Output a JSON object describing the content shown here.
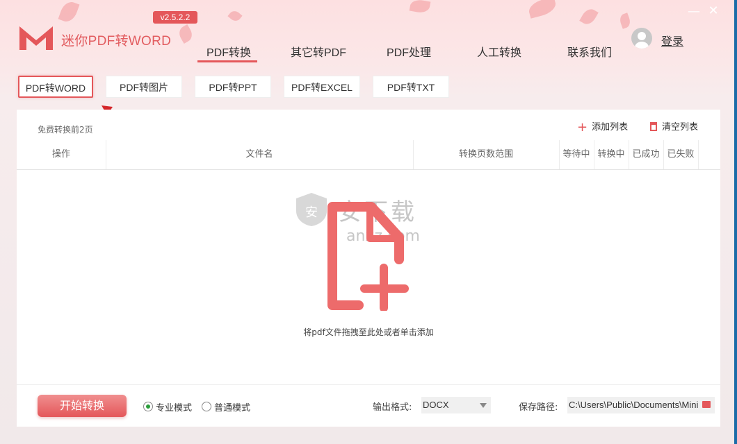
{
  "header": {
    "app_title": "迷你PDF转WORD",
    "version": "v2.5.2.2",
    "nav": [
      "PDF转换",
      "其它转PDF",
      "PDF处理",
      "人工转换",
      "联系我们"
    ],
    "login": "登录",
    "accent_color": "#e4575a"
  },
  "subtabs": [
    "PDF转WORD",
    "PDF转图片",
    "PDF转PPT",
    "PDF转EXCEL",
    "PDF转TXT"
  ],
  "panel": {
    "free_note": "免费转换前2页",
    "add_list": "添加列表",
    "clear_list": "清空列表",
    "columns": [
      "操作",
      "文件名",
      "转换页数范围",
      "等待中",
      "转换中",
      "已成功",
      "已失败"
    ],
    "drop_hint": "将pdf文件拖拽至此处或者单击添加"
  },
  "watermark": {
    "text": "安下载",
    "sub": "anxz.com"
  },
  "bottom": {
    "start_button": "开始转换",
    "modes": [
      "专业模式",
      "普通模式"
    ],
    "selected_mode": "专业模式",
    "format_label": "输出格式:",
    "format_value": "DOCX",
    "path_label": "保存路径:",
    "path_value": "C:\\Users\\Public\\Documents\\Mini"
  }
}
